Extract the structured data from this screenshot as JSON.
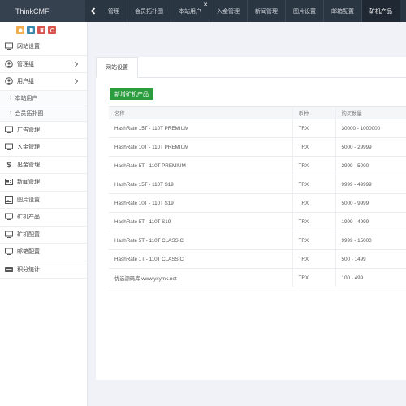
{
  "app": {
    "brand": "ThinkCMF"
  },
  "topbar": {
    "tabs": [
      {
        "label": "管理"
      },
      {
        "label": "会员拓扑图"
      },
      {
        "label": "本站用户"
      },
      {
        "label": "入金管理"
      },
      {
        "label": "新闻管理"
      },
      {
        "label": "图片设置"
      },
      {
        "label": "邮箱配置"
      },
      {
        "label": "矿机产品"
      }
    ],
    "active_tab": 7
  },
  "sidebar": {
    "quick_buttons": [
      {
        "icon": "home-icon",
        "color": "#f0ad4e"
      },
      {
        "icon": "document-icon",
        "color": "#3a87ad"
      },
      {
        "icon": "trash-icon",
        "color": "#d9534f"
      },
      {
        "icon": "refresh-icon",
        "color": "#d9534f"
      }
    ],
    "items": [
      {
        "label": "网站设置",
        "icon": "monitor-icon"
      },
      {
        "label": "管理组",
        "icon": "user-circle-icon",
        "chevron": true
      },
      {
        "label": "用户组",
        "icon": "user-circle-icon",
        "chevron": true,
        "expanded": true
      },
      {
        "label": "广告管理",
        "icon": "monitor-icon"
      },
      {
        "label": "入金管理",
        "icon": "monitor-icon"
      },
      {
        "label": "出金管理",
        "icon": "dollar-icon"
      },
      {
        "label": "新闻管理",
        "icon": "newspaper-icon"
      },
      {
        "label": "图片设置",
        "icon": "picture-icon"
      },
      {
        "label": "矿机产品",
        "icon": "monitor-icon"
      },
      {
        "label": "矿机配置",
        "icon": "monitor-icon"
      },
      {
        "label": "邮箱配置",
        "icon": "monitor-icon"
      },
      {
        "label": "积分统计",
        "icon": "visa-icon"
      }
    ],
    "submenu": [
      {
        "label": "本站用户"
      },
      {
        "label": "会员拓扑图"
      }
    ]
  },
  "main": {
    "panel_tab": "网站设置",
    "add_button": "新增矿机产品",
    "table": {
      "headers": [
        "名称",
        "币种",
        "购买数量"
      ],
      "rows": [
        [
          "HashRate 15T - 110T PREMIUM",
          "TRX",
          "30000 - 1000000"
        ],
        [
          "HashRate 10T - 110T PREMIUM",
          "TRX",
          "5000 - 29999"
        ],
        [
          "HashRate 5T - 110T PREMIUM",
          "TRX",
          "2999 - 5000"
        ],
        [
          "HashRate 15T - 110T S19",
          "TRX",
          "9999 - 49999"
        ],
        [
          "HashRate 10T - 110T S19",
          "TRX",
          "5000 - 9999"
        ],
        [
          "HashRate 5T - 110T S19",
          "TRX",
          "1999 - 4999"
        ],
        [
          "HashRate 5T - 110T CLASSIC",
          "TRX",
          "9999 - 15000"
        ],
        [
          "HashRate 1T - 110T CLASSIC",
          "TRX",
          "500 - 1499"
        ],
        [
          "优选源码库 www.yxymk.net",
          "TRX",
          "100 - 499"
        ]
      ]
    }
  },
  "colors": {
    "topbar": "#2b3643",
    "accent_green": "#2b9d3f"
  }
}
